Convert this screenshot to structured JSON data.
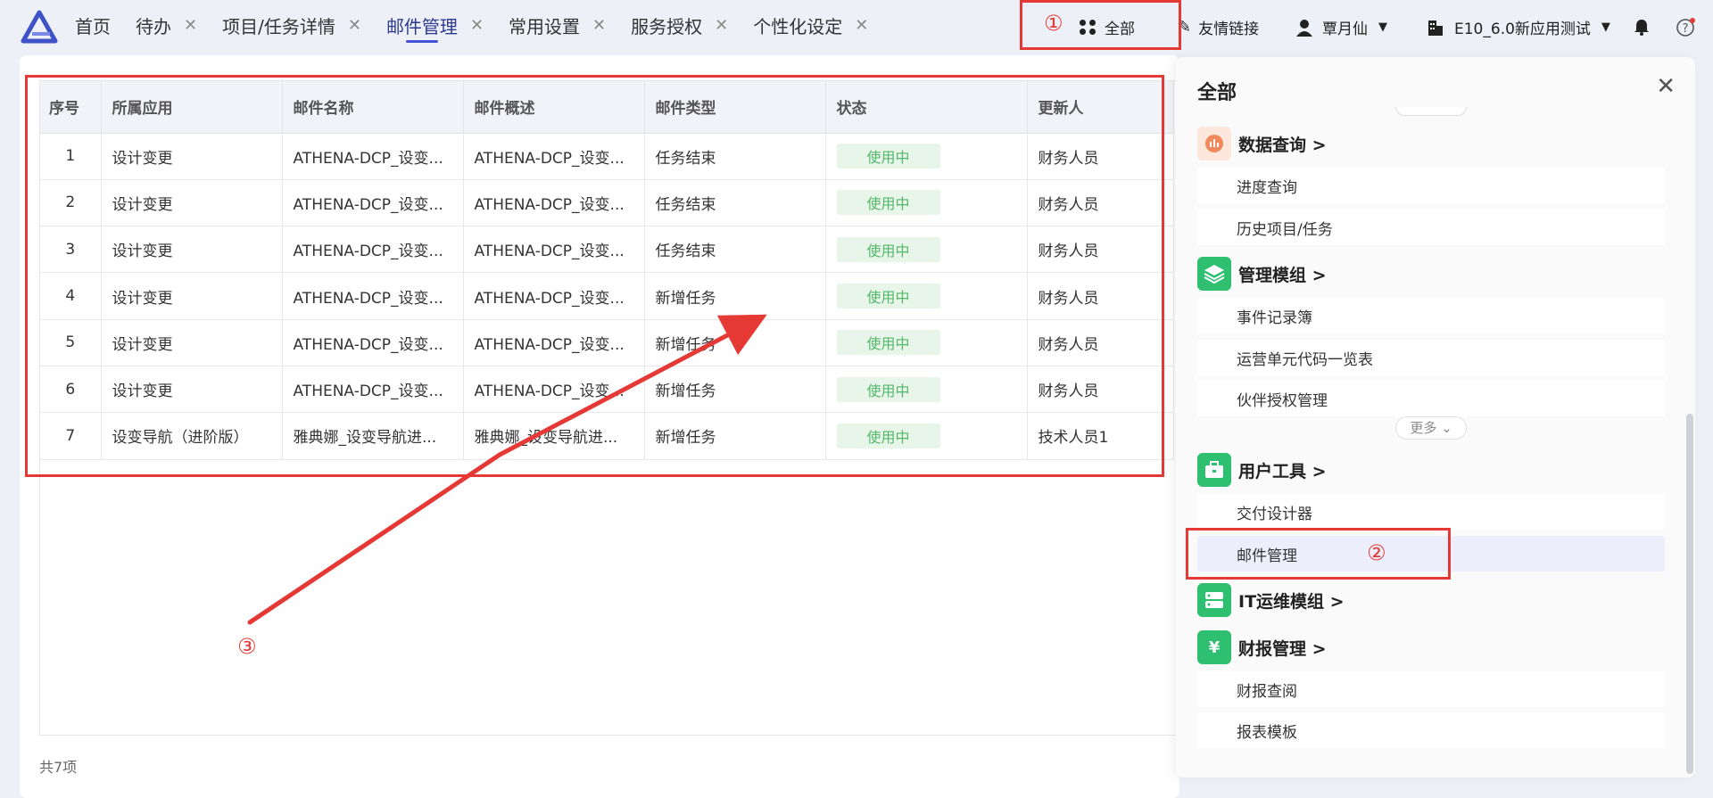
{
  "tabs": [
    {
      "label": "首页",
      "closable": false,
      "active": false
    },
    {
      "label": "待办",
      "closable": true,
      "active": false
    },
    {
      "label": "项目/任务详情",
      "closable": true,
      "active": false
    },
    {
      "label": "邮件管理",
      "closable": true,
      "active": true
    },
    {
      "label": "常用设置",
      "closable": true,
      "active": false
    },
    {
      "label": "服务授权",
      "closable": true,
      "active": false
    },
    {
      "label": "个性化设定",
      "closable": true,
      "active": false
    }
  ],
  "toolbar": {
    "all_label": "全部",
    "friend_links_label": "友情链接",
    "user_name": "覃月仙",
    "tenant_name": "E10_6.0新应用测试",
    "annotation_1": "①"
  },
  "table": {
    "columns": [
      "序号",
      "所属应用",
      "邮件名称",
      "邮件概述",
      "邮件类型",
      "状态",
      "更新人"
    ],
    "rows": [
      [
        "1",
        "设计变更",
        "ATHENA-DCP_设变...",
        "ATHENA-DCP_设变...",
        "任务结束",
        "使用中",
        "财务人员"
      ],
      [
        "2",
        "设计变更",
        "ATHENA-DCP_设变...",
        "ATHENA-DCP_设变...",
        "任务结束",
        "使用中",
        "财务人员"
      ],
      [
        "3",
        "设计变更",
        "ATHENA-DCP_设变...",
        "ATHENA-DCP_设变...",
        "任务结束",
        "使用中",
        "财务人员"
      ],
      [
        "4",
        "设计变更",
        "ATHENA-DCP_设变...",
        "ATHENA-DCP_设变...",
        "新增任务",
        "使用中",
        "财务人员"
      ],
      [
        "5",
        "设计变更",
        "ATHENA-DCP_设变...",
        "ATHENA-DCP_设变...",
        "新增任务",
        "使用中",
        "财务人员"
      ],
      [
        "6",
        "设计变更",
        "ATHENA-DCP_设变...",
        "ATHENA-DCP_设变...",
        "新增任务",
        "使用中",
        "财务人员"
      ],
      [
        "7",
        "设变导航（进阶版）",
        "雅典娜_设变导航进...",
        "雅典娜_设变导航进...",
        "新增任务",
        "使用中",
        "技术人员1"
      ]
    ],
    "footer": "共7项",
    "annotation_3": "③"
  },
  "panel": {
    "title": "全部",
    "categories": [
      {
        "label": "数据查询 >",
        "icon": "chart-icon",
        "color": "#f08a5d",
        "items": [
          "进度查询",
          "历史项目/任务"
        ]
      },
      {
        "label": "管理模组 >",
        "icon": "layers-icon",
        "color": "#2fbf71",
        "items": [
          "事件记录簿",
          "运营单元代码一览表",
          "伙伴授权管理"
        ],
        "more": "更多"
      },
      {
        "label": "用户工具 >",
        "icon": "toolbox-icon",
        "color": "#2fbf71",
        "items": [
          "交付设计器",
          "邮件管理"
        ]
      },
      {
        "label": "IT运维模组 >",
        "icon": "server-icon",
        "color": "#2fbf71",
        "items": []
      },
      {
        "label": "财报管理 >",
        "icon": "yen-icon",
        "color": "#2fbf71",
        "items": [
          "财报查阅",
          "报表模板"
        ]
      }
    ],
    "annotation_2": "②"
  }
}
